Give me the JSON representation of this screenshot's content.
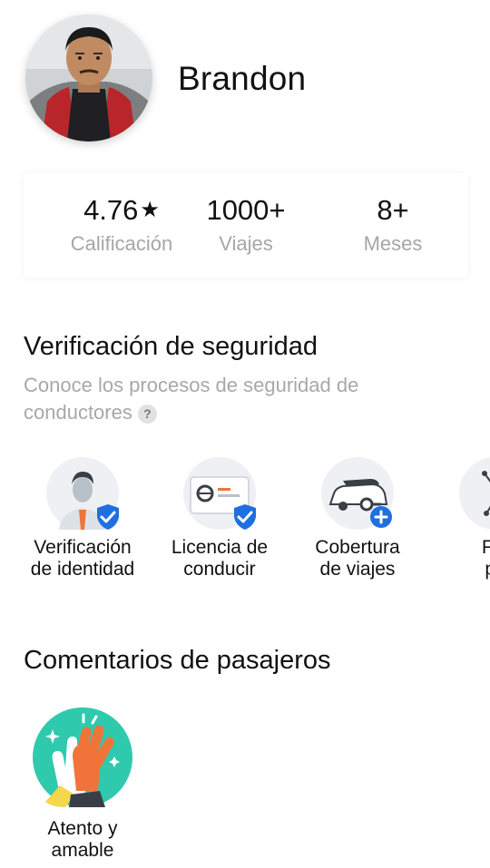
{
  "profile": {
    "name": "Brandon"
  },
  "stats": [
    {
      "value": "4.76",
      "suffix": "★",
      "label": "Calificación"
    },
    {
      "value": "1000+",
      "suffix": "",
      "label": "Viajes"
    },
    {
      "value": "8+",
      "suffix": "",
      "label": "Meses"
    }
  ],
  "safety": {
    "title": "Verificación de seguridad",
    "description": "Conoce los procesos de seguridad de conductores",
    "help_icon": "?",
    "badges": [
      {
        "icon": "identity-verification-icon",
        "line1": "Verificación",
        "line2": "de identidad"
      },
      {
        "icon": "driver-license-icon",
        "line1": "Licencia de",
        "line2": "conducir"
      },
      {
        "icon": "trip-coverage-icon",
        "line1": "Cobertura",
        "line2": "de viajes"
      },
      {
        "icon": "photo-icon",
        "line1": "Fot",
        "line2": "pe"
      }
    ]
  },
  "feedback": {
    "title": "Comentarios de pasajeros",
    "badges": [
      {
        "icon": "high-five-icon",
        "line1": "Atento y",
        "line2": "amable"
      }
    ]
  },
  "colors": {
    "accent_blue": "#1f6fe0",
    "teal": "#2fc9ae",
    "orange": "#f0743a",
    "muted_text": "#a8a8a8"
  }
}
